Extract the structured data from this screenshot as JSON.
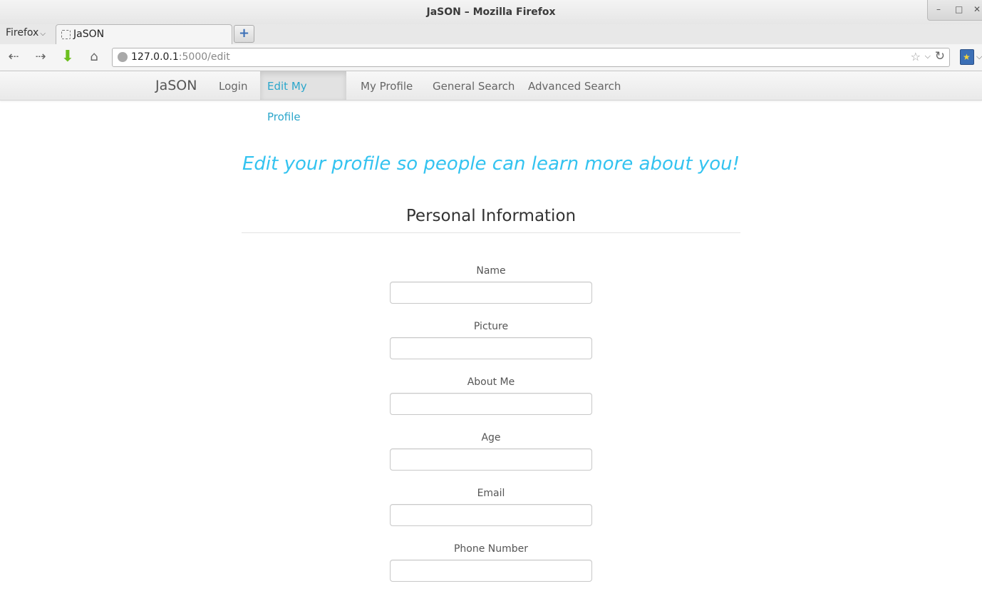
{
  "window": {
    "title": "JaSON – Mozilla Firefox",
    "controls": [
      "–",
      "□",
      "✕"
    ]
  },
  "browser": {
    "menu_label": "Firefox",
    "tab_title": "JaSON",
    "new_tab": "+",
    "url_host": "127.0.0.1",
    "url_path": ":5000/edit"
  },
  "sitenav": {
    "brand": "JaSON",
    "links": [
      "Login",
      "Edit My Profile",
      "My Profile",
      "General Search",
      "Advanced Search"
    ],
    "active_link": "Edit My Profile"
  },
  "main": {
    "lead": "Edit your profile so people can learn more about you!",
    "section_title": "Personal Information",
    "fields": [
      {
        "label": "Name",
        "value": ""
      },
      {
        "label": "Picture",
        "value": ""
      },
      {
        "label": "About Me",
        "value": ""
      },
      {
        "label": "Age",
        "value": ""
      },
      {
        "label": "Email",
        "value": ""
      },
      {
        "label": "Phone Number",
        "value": ""
      }
    ]
  },
  "colors": {
    "accent": "#33c3f0",
    "active_link": "#2ba6cb",
    "text": "#555555"
  },
  "icons": [
    "back-icon",
    "forward-icon",
    "download-icon",
    "home-icon",
    "globe-icon",
    "star-icon",
    "reload-icon",
    "bookmarks-icon"
  ]
}
